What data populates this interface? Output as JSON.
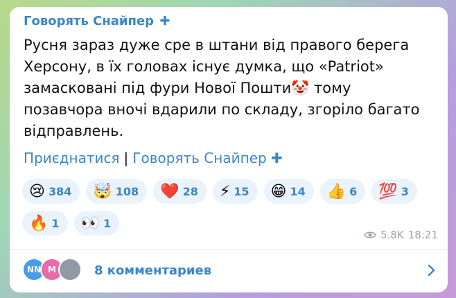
{
  "post": {
    "channel_name": "Говорять Снайпер",
    "channel_cross": "✚",
    "text": "Русня зараз дуже сре в штани від правого берега Херсону, в їх головах існує думка, що «Patriot» замасковані під фури Нової Пошти🤡 тому позавчора вночі вдарили по складу, згоріло багато відправлень.",
    "link_join": "Приєднатися",
    "link_separator": "|",
    "link_channel": "Говорять Снайпер ✚",
    "views": "5.8K",
    "time": "18:21"
  },
  "reactions": [
    {
      "emoji": "😢",
      "count": "384"
    },
    {
      "emoji": "🤯",
      "count": "108"
    },
    {
      "emoji": "❤️",
      "count": "28"
    },
    {
      "emoji": "⚡",
      "count": "15"
    },
    {
      "emoji": "😁",
      "count": "14"
    },
    {
      "emoji": "👍",
      "count": "6"
    },
    {
      "emoji": "💯",
      "count": "3"
    },
    {
      "emoji": "🔥",
      "count": "1"
    },
    {
      "emoji": "👀",
      "count": "1"
    }
  ],
  "comments": {
    "avatars": [
      "NN",
      "M",
      ""
    ],
    "label": "8 комментариев"
  },
  "colors": {
    "accent": "#3a86c8",
    "reaction_bg": "#eaf3fb"
  },
  "icons": [
    "eye-icon",
    "chevron-right-icon",
    "cross-icon"
  ]
}
